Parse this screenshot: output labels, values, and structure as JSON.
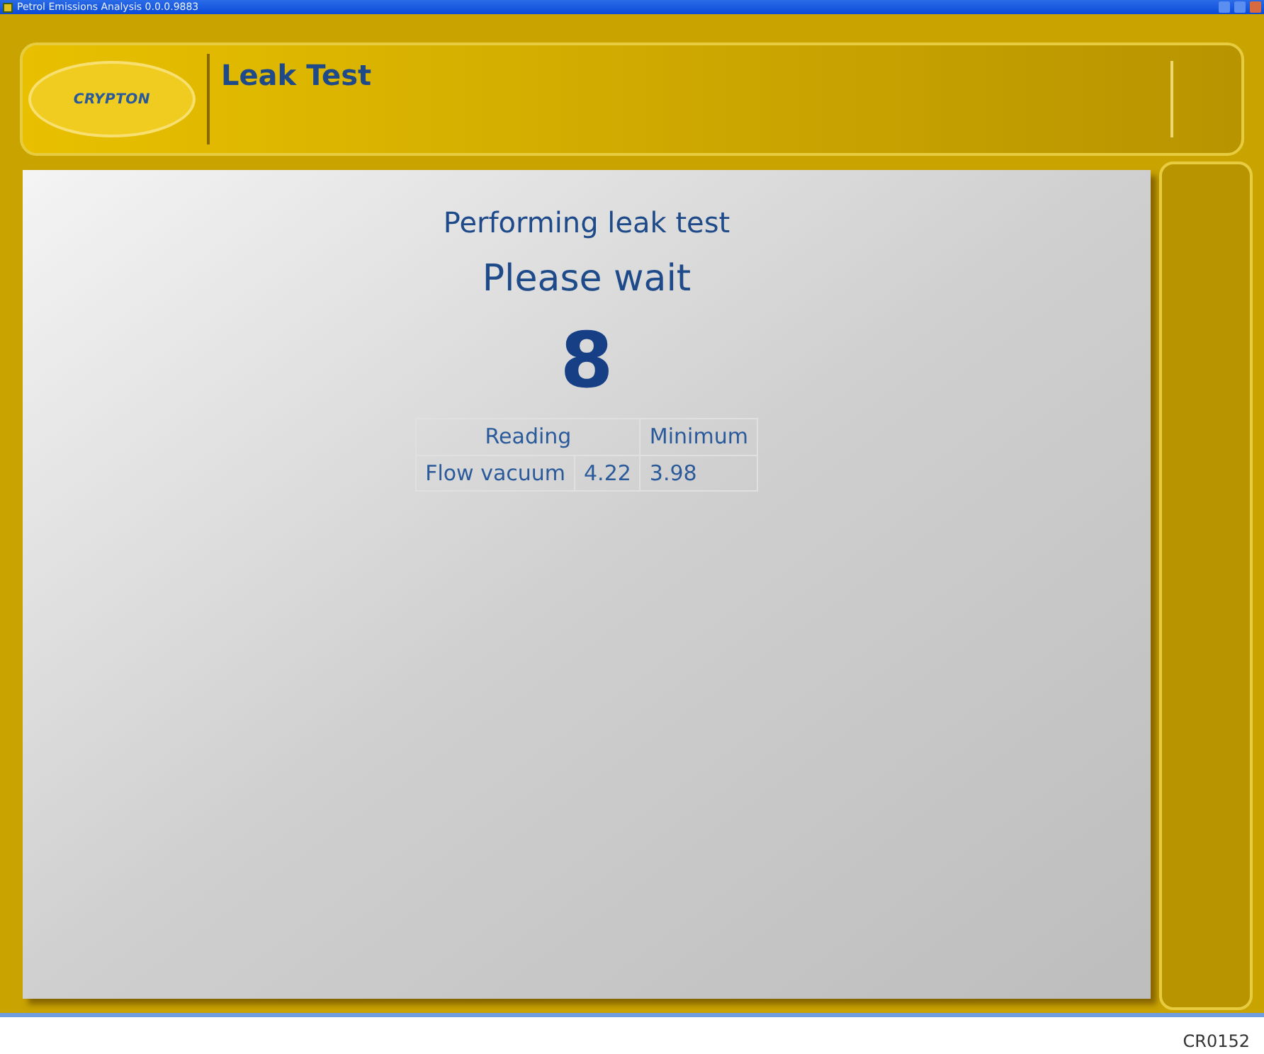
{
  "window": {
    "title": "Petrol Emissions Analysis 0.0.0.9883"
  },
  "header": {
    "logo": "CRYPTON",
    "title": "Leak Test"
  },
  "status": {
    "message": "Performing leak test",
    "prompt": "Please wait",
    "countdown": "8"
  },
  "table": {
    "columns": [
      "Reading",
      "Minimum"
    ],
    "rows": [
      {
        "label": "Flow vacuum",
        "reading": "4.22",
        "minimum": "3.98"
      }
    ]
  },
  "caption": "CR0152"
}
